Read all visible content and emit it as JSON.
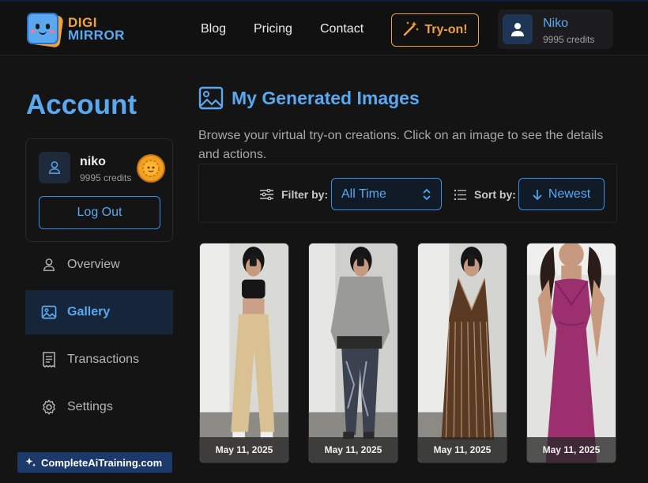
{
  "brand": {
    "line1": "DIGI",
    "line2": "MIRROR"
  },
  "nav": {
    "items": [
      "Blog",
      "Pricing",
      "Contact"
    ],
    "try_on_label": "Try-on!"
  },
  "user": {
    "name": "Niko",
    "credits": "9995 credits"
  },
  "account": {
    "title": "Account",
    "profile_name": "niko",
    "profile_credits": "9995 credits",
    "logout_label": "Log Out"
  },
  "sidebar": {
    "items": [
      {
        "label": "Overview",
        "icon": "user-icon",
        "active": false
      },
      {
        "label": "Gallery",
        "icon": "image-icon",
        "active": true
      },
      {
        "label": "Transactions",
        "icon": "receipt-icon",
        "active": false
      },
      {
        "label": "Settings",
        "icon": "gear-icon",
        "active": false
      }
    ]
  },
  "watermark": "CompleteAiTraining.com",
  "main": {
    "title": "My Generated Images",
    "subtitle": "Browse your virtual try-on creations. Click on an image to see the details and actions.",
    "filter_label": "Filter by:",
    "filter_value": "All Time",
    "sort_label": "Sort by:",
    "sort_value": "Newest"
  },
  "gallery": [
    {
      "date": "May 11, 2025",
      "outfit": "black crop top, beige trousers"
    },
    {
      "date": "May 11, 2025",
      "outfit": "grey sweater, patterned leggings"
    },
    {
      "date": "May 11, 2025",
      "outfit": "striped brown jumpsuit"
    },
    {
      "date": "May 11, 2025",
      "outfit": "magenta maxi dress"
    }
  ],
  "colors": {
    "accent": "#5aa9f0",
    "brand_orange": "#f0a33a",
    "background": "#141414"
  }
}
